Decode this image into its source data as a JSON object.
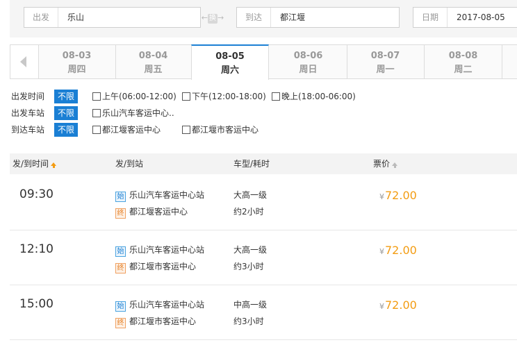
{
  "search": {
    "depart_label": "出发",
    "depart_value": "乐山",
    "swap_label": "换",
    "arrive_label": "到达",
    "arrive_value": "都江堰",
    "date_label": "日期",
    "date_value": "2017-08-05"
  },
  "dates": [
    {
      "date": "08-03",
      "weekday": "周四",
      "active": false
    },
    {
      "date": "08-04",
      "weekday": "周五",
      "active": false
    },
    {
      "date": "08-05",
      "weekday": "周六",
      "active": true
    },
    {
      "date": "08-06",
      "weekday": "周日",
      "active": false
    },
    {
      "date": "08-07",
      "weekday": "周一",
      "active": false
    },
    {
      "date": "08-08",
      "weekday": "周二",
      "active": false
    }
  ],
  "filters": {
    "no_limit": "不限",
    "time": {
      "title": "出发时间",
      "options": [
        "上午(06:00-12:00)",
        "下午(12:00-18:00)",
        "晚上(18:00-06:00)"
      ]
    },
    "depart_station": {
      "title": "出发车站",
      "options": [
        "乐山汽车客运中心.."
      ]
    },
    "arrive_station": {
      "title": "到达车站",
      "options": [
        "都江堰客运中心",
        "都江堰市客运中心"
      ]
    }
  },
  "table": {
    "headers": {
      "time": "发/到时间",
      "station": "发/到站",
      "bus": "车型/耗时",
      "price": "票价"
    },
    "start_tag": "始",
    "end_tag": "终",
    "currency": "¥",
    "rows": [
      {
        "time": "09:30",
        "from": "乐山汽车客运中心站",
        "to": "都江堰客运中心",
        "bus_type": "大高一级",
        "duration": "约2小时",
        "price": "72.00"
      },
      {
        "time": "12:10",
        "from": "乐山汽车客运中心站",
        "to": "都江堰市客运中心",
        "bus_type": "大高一级",
        "duration": "约3小时",
        "price": "72.00"
      },
      {
        "time": "15:00",
        "from": "乐山汽车客运中心站",
        "to": "都江堰市客运中心",
        "bus_type": "中高一级",
        "duration": "约3小时",
        "price": "72.00"
      }
    ]
  },
  "colors": {
    "accent": "#1a7fd4",
    "price": "#f39c12"
  }
}
